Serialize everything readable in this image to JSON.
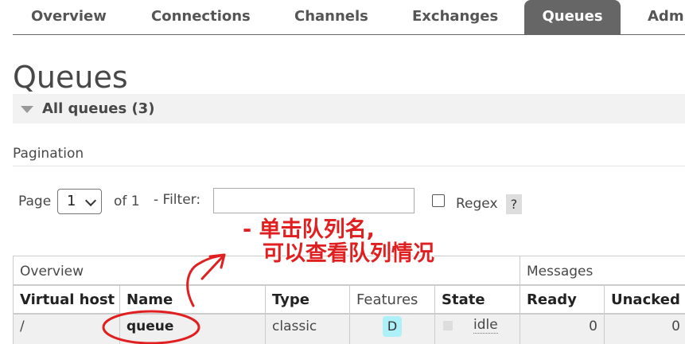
{
  "nav": {
    "tabs": [
      {
        "label": "Overview"
      },
      {
        "label": "Connections"
      },
      {
        "label": "Channels"
      },
      {
        "label": "Exchanges"
      },
      {
        "label": "Queues",
        "active": true
      },
      {
        "label": "Admin"
      }
    ]
  },
  "page": {
    "title": "Queues"
  },
  "section": {
    "label": "All queues (3)"
  },
  "pagination": {
    "label": "Pagination",
    "page_label": "Page",
    "page_value": "1",
    "of_label": "of 1",
    "filter_label": "- Filter:",
    "filter_value": "",
    "regex_label": "Regex",
    "help_label": "?"
  },
  "table": {
    "groups": {
      "overview": "Overview",
      "messages": "Messages"
    },
    "headers": {
      "virtual_host": "Virtual host",
      "name": "Name",
      "type": "Type",
      "features": "Features",
      "state": "State",
      "ready": "Ready",
      "unacked": "Unacked"
    },
    "rows": [
      {
        "virtual_host": "/",
        "name": "queue",
        "type": "classic",
        "features": "D",
        "state": "idle",
        "ready": "0",
        "unacked": "0"
      }
    ]
  },
  "annotation": {
    "line1": "- 单击队列名,",
    "line2": "可以查看队列情况",
    "color": "#e02020"
  },
  "colors": {
    "active_tab": "#666666",
    "feature_badge": "#aef0f8"
  }
}
